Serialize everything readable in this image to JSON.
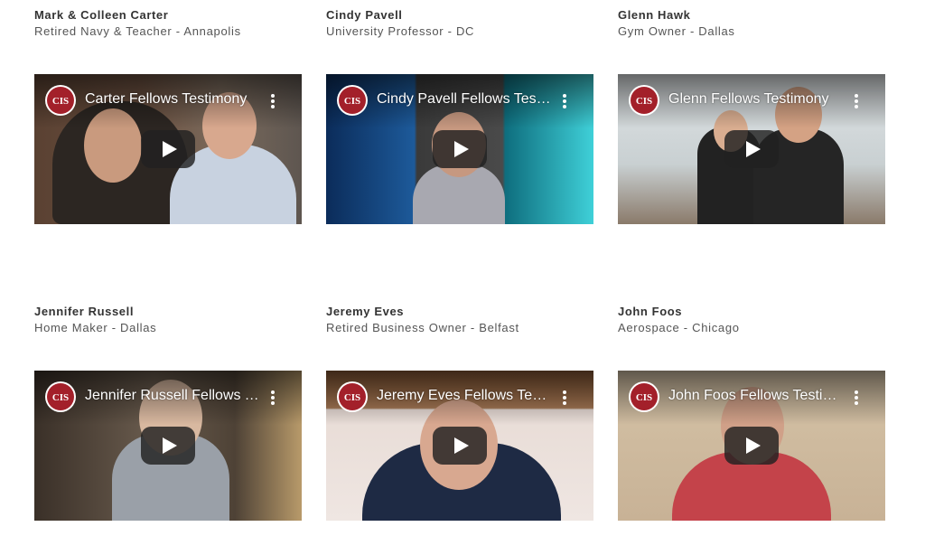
{
  "logo_color": "#a3202a",
  "icons": {
    "logo": "cis-logo-icon",
    "play": "play-icon",
    "menu": "more-vert-icon"
  },
  "cards": [
    {
      "name": "Mark & Colleen Carter",
      "role": "Retired Navy & Teacher - Annapolis",
      "video_title": "Carter Fellows Testimony"
    },
    {
      "name": "Cindy Pavell",
      "role": "University Professor - DC",
      "video_title": "Cindy Pavell Fellows Testimony"
    },
    {
      "name": "Glenn Hawk",
      "role": "Gym Owner - Dallas",
      "video_title": "Glenn Fellows Testimony"
    },
    {
      "name": "Jennifer Russell",
      "role": "Home Maker - Dallas",
      "video_title": "Jennifer Russell Fellows Testimony"
    },
    {
      "name": "Jeremy Eves",
      "role": "Retired Business Owner - Belfast",
      "video_title": "Jeremy Eves Fellows Testimony"
    },
    {
      "name": "John Foos",
      "role": "Aerospace - Chicago",
      "video_title": "John Foos Fellows Testimony"
    }
  ]
}
